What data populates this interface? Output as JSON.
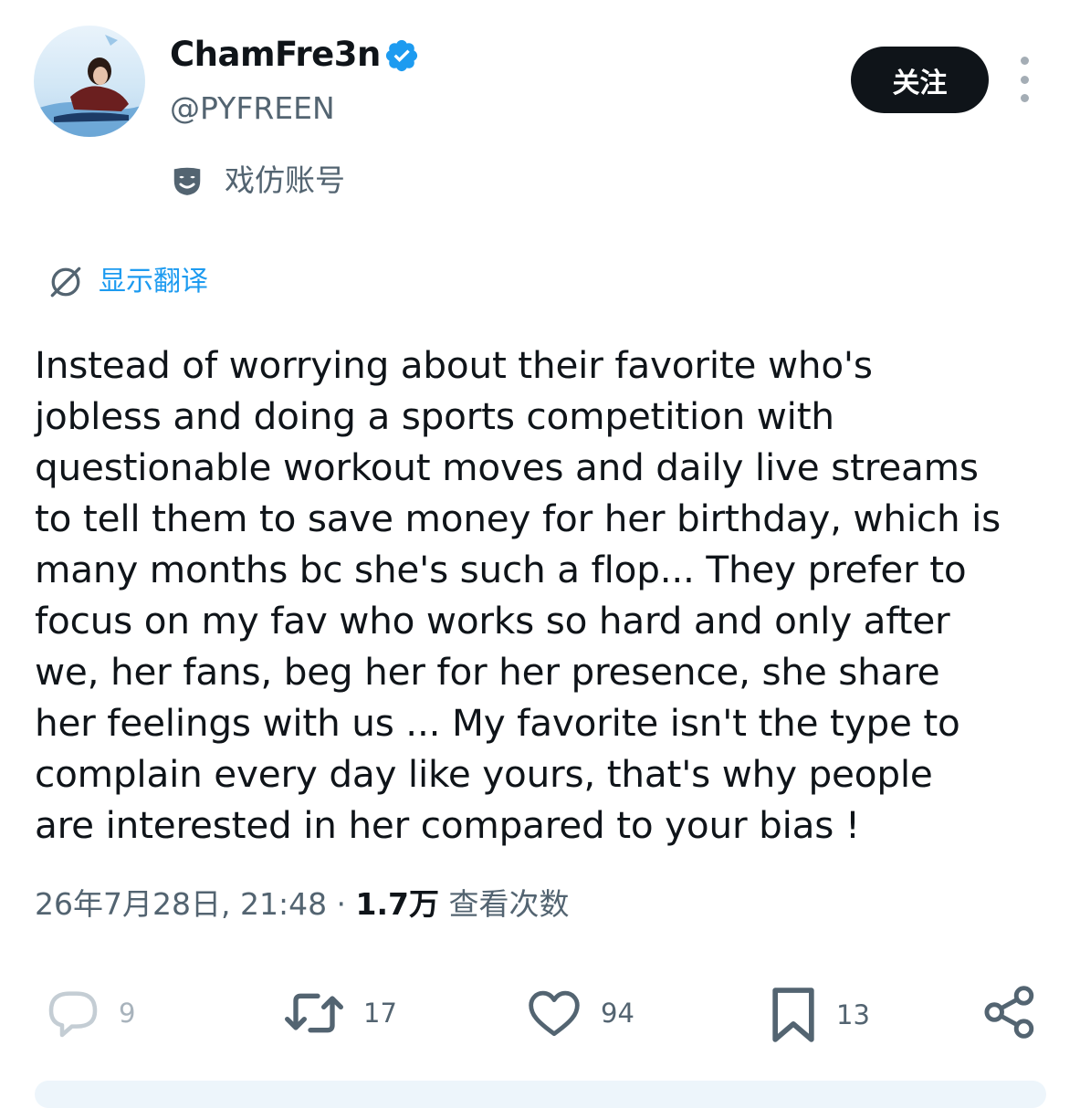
{
  "author": {
    "display_name": "ChamFre3n",
    "handle": "@PYFREEN",
    "verified": true,
    "account_label": "戏仿账号"
  },
  "actions": {
    "follow_label": "关注",
    "more_icon": "more-vertical-icon"
  },
  "translate": {
    "label": "显示翻译",
    "icon": "translate-icon"
  },
  "tweet": {
    "lines": [
      "Instead of worrying about their favorite who's",
      "jobless and doing a sports competition with",
      "questionable workout moves and daily live streams",
      "to tell them to save money for her birthday, which is",
      "many months bc she's such a flop... They prefer to",
      "focus on my fav who works so hard and only after",
      "we, her fans, beg her for her presence, she share",
      "her feelings with us ... My favorite isn't the type to",
      "complain every day like yours, that's why people",
      "are interested in her compared to your bias !"
    ]
  },
  "meta": {
    "timestamp": "26年7月28日, 21:48",
    "separator": " · ",
    "views_count": "1.7万",
    "views_label": "查看次数"
  },
  "engagement": {
    "replies": "9",
    "retweets": "17",
    "likes": "94",
    "bookmarks": "13"
  },
  "colors": {
    "accent": "#1d9bf0",
    "text": "#0f1419",
    "secondary": "#536471",
    "icon_gray": "#536471"
  }
}
